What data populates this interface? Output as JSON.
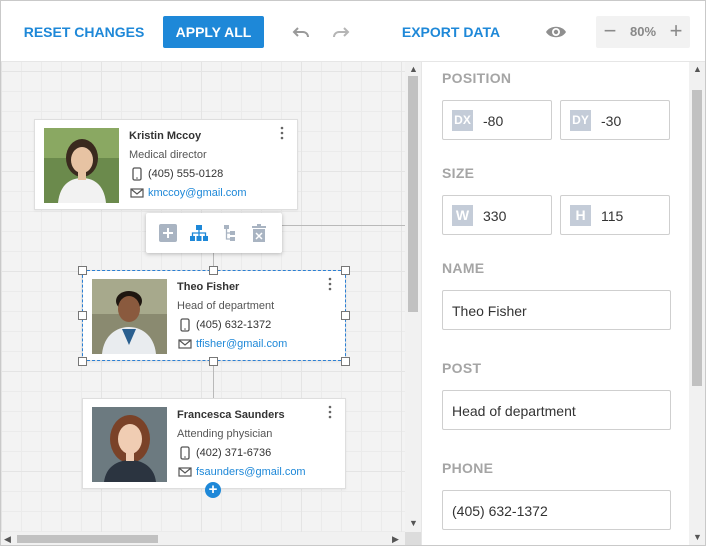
{
  "toolbar": {
    "reset_label": "RESET CHANGES",
    "apply_label": "APPLY ALL",
    "export_label": "EXPORT DATA",
    "zoom_value": "80%",
    "zoom_minus": "−",
    "zoom_plus": "+",
    "undo_icon": "undo-icon",
    "redo_icon": "redo-icon",
    "preview_icon": "eye-icon"
  },
  "canvas": {
    "cards": [
      {
        "name": "Kristin Mccoy",
        "post": "Medical director",
        "phone": "(405) 555-0128",
        "email": "kmccoy@gmail.com"
      },
      {
        "name": "Theo Fisher",
        "post": "Head of department",
        "phone": "(405) 632-1372",
        "email": "tfisher@gmail.com"
      },
      {
        "name": "Francesca Saunders",
        "post": "Attending physician",
        "phone": "(402) 371-6736",
        "email": "fsaunders@gmail.com"
      }
    ],
    "node_toolbar": [
      "add-node-icon",
      "hierarchy-icon",
      "tree-branch-icon",
      "delete-icon"
    ],
    "add_child": "+"
  },
  "panel": {
    "position_label": "POSITION",
    "dx_tag": "DX",
    "dx_value": "-80",
    "dy_tag": "DY",
    "dy_value": "-30",
    "size_label": "SIZE",
    "w_tag": "W",
    "w_value": "330",
    "h_tag": "H",
    "h_value": "115",
    "name_label": "NAME",
    "name_value": "Theo Fisher",
    "post_label": "POST",
    "post_value": "Head of department",
    "phone_label": "PHONE",
    "phone_value": "(405) 632-1372"
  },
  "colors": {
    "accent": "#1e88d8",
    "label_gray": "#a5a5a5",
    "tag_bg": "#c4ccd8"
  }
}
